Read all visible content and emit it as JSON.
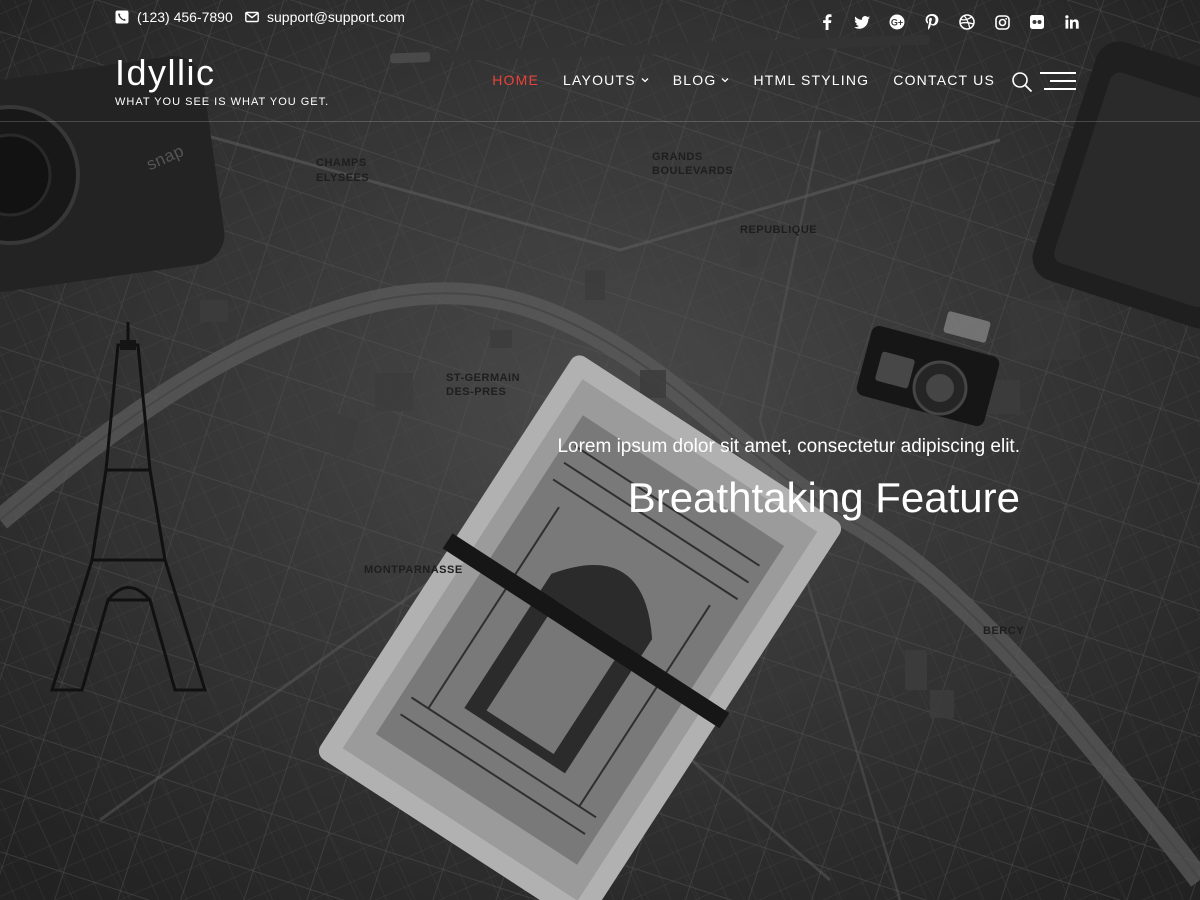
{
  "topbar": {
    "phone": "(123) 456-7890",
    "email": "support@support.com",
    "social": [
      {
        "name": "facebook-icon",
        "glyph": "f"
      },
      {
        "name": "twitter-icon",
        "glyph": ""
      },
      {
        "name": "google-plus-icon",
        "glyph": ""
      },
      {
        "name": "pinterest-icon",
        "glyph": ""
      },
      {
        "name": "dribbble-icon",
        "glyph": ""
      },
      {
        "name": "instagram-icon",
        "glyph": ""
      },
      {
        "name": "flickr-icon",
        "glyph": ""
      },
      {
        "name": "linkedin-icon",
        "glyph": "in"
      }
    ]
  },
  "header": {
    "site_title": "Idyllic",
    "tagline": "WHAT YOU SEE IS WHAT YOU GET.",
    "nav": [
      {
        "label": "HOME",
        "active": true,
        "dropdown": false
      },
      {
        "label": "LAYOUTS",
        "active": false,
        "dropdown": true
      },
      {
        "label": "BLOG",
        "active": false,
        "dropdown": true
      },
      {
        "label": "HTML STYLING",
        "active": false,
        "dropdown": false
      },
      {
        "label": "CONTACT US",
        "active": false,
        "dropdown": false
      }
    ]
  },
  "slide": {
    "subtitle": "Lorem ipsum dolor sit amet, consectetur adipiscing elit.",
    "title": "Breathtaking Feature"
  },
  "colors": {
    "accent": "#e8433a",
    "text": "#ffffff",
    "background": "#3c3c3c"
  },
  "map_labels": {
    "l1": "CHAMPS",
    "l2": "ELYSEES",
    "l3": "GRANDS",
    "l4": "BOULEVARDS",
    "l5": "REPUBLIQUE",
    "l6": "ST-GERMAIN",
    "l7": "DES-PRES",
    "l8": "MONTPARNASSE",
    "l9": "BERCY",
    "l10": "snap"
  }
}
